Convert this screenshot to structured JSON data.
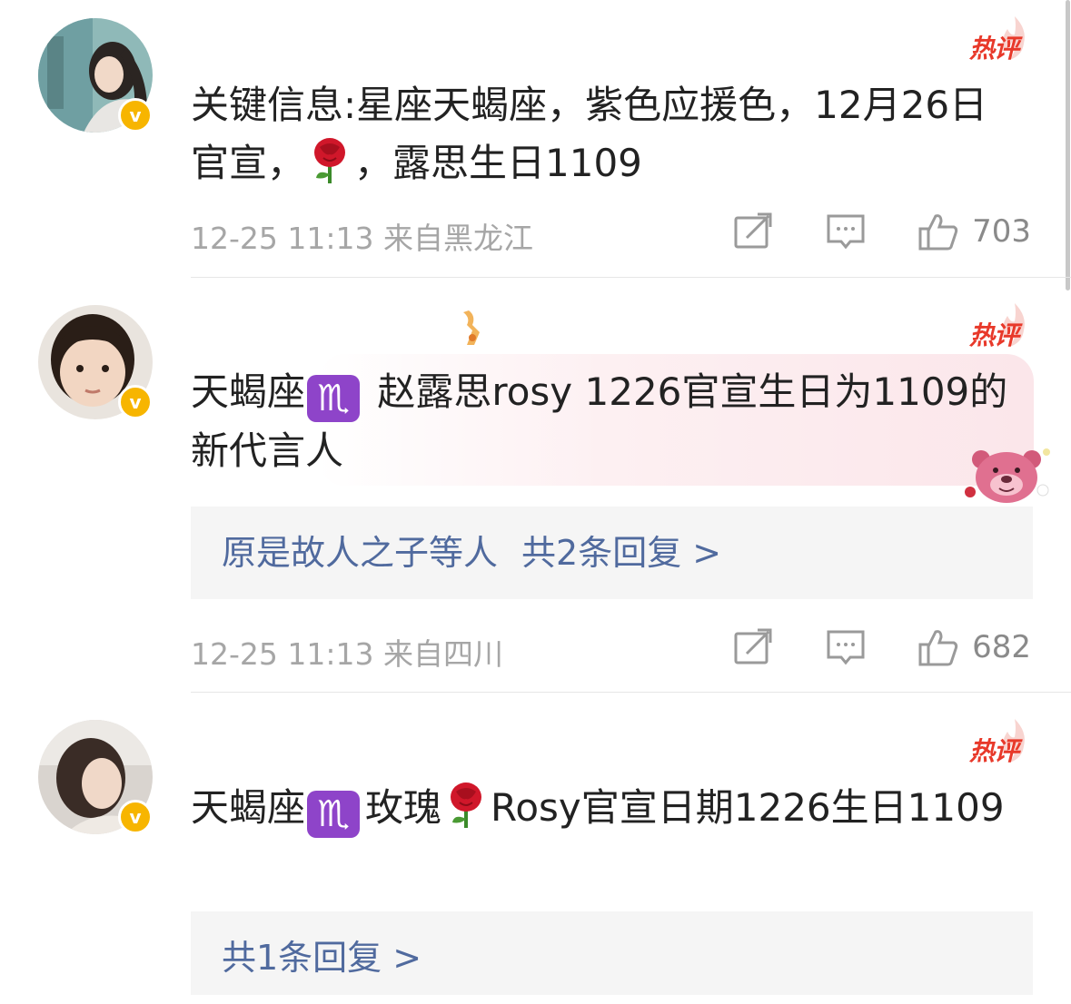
{
  "comments": [
    {
      "badge": "热评",
      "text_before": "关键信息:星座天蝎座，紫色应援色，12月26日官宣，",
      "emoji": "rose",
      "text_after": "，露思生日1109",
      "timestamp": "12-25 11:13",
      "location": "来自黑龙江",
      "likes": "703"
    },
    {
      "badge": "热评",
      "text_before": "天蝎座",
      "zodiac_symbol": "♏",
      "text_after": " 赵露思rosy 1226官宣生日为1109的新代言人",
      "reply_users": "原是故人之子等人",
      "reply_count": "共2条回复 >",
      "timestamp": "12-25 11:13",
      "location": "来自四川",
      "likes": "682"
    },
    {
      "badge": "热评",
      "text_before": "天蝎座",
      "zodiac_symbol": "♏",
      "text_mid": "玫瑰",
      "emoji": "rose",
      "text_after": "Rosy官宣日期1226生日1109",
      "reply_count": "共1条回复 >"
    }
  ],
  "verified_badge": "v",
  "icons": {
    "repost": "repost-icon",
    "comment": "comment-icon",
    "like": "thumbs-up-icon"
  },
  "colors": {
    "hot_red": "#e8392a",
    "verified_yellow": "#f7b500",
    "link_blue": "#506a9e",
    "meta_gray": "#a6a6a6",
    "zodiac_purple": "#8e44c9"
  }
}
